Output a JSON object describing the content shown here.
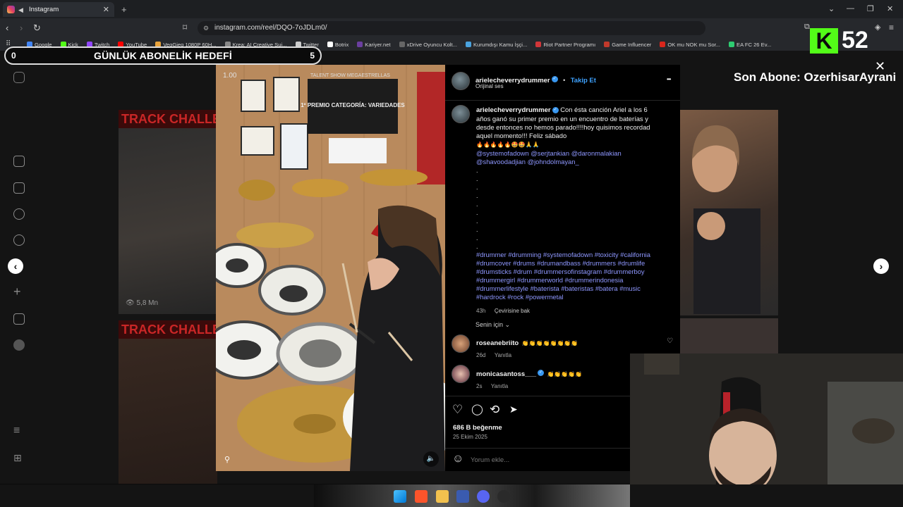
{
  "browser": {
    "tab_title": "Instagram",
    "url": "instagram.com/reel/DQO-7oJDLm0/",
    "bookmarks": [
      "Google",
      "Kick",
      "Twitch",
      "YouTube",
      "VegGieg 1080P 60H...",
      "Krea: AI Creative Sui...",
      "Twitter",
      "Botrix",
      "Kariyer.net",
      "xDrive Oyuncu Kolt...",
      "Kurumdışı Kamu İşçi...",
      "Riot Partner Programı",
      "Game Influencer",
      "OK mu NOK mu Sor...",
      "EA FC 26 Ev..."
    ],
    "bookmark_colors": [
      "#4285f4",
      "#53fc18",
      "#9146ff",
      "#ff0000",
      "#e8a33c",
      "#888888",
      "#cccccc",
      "#ffffff",
      "#6b3fa0",
      "#666666",
      "#4aa3df",
      "#d13639",
      "#c0392b",
      "#d9261c",
      "#2ecc71"
    ]
  },
  "overlay": {
    "goal_left": "0",
    "goal_title": "GÜNLÜK ABONELİK HEDEFİ",
    "goal_right": "5",
    "kick_logo": "K",
    "kick_count": "52",
    "last_sub": "Son Abone: OzerhisarAyrani"
  },
  "background": {
    "track_label_1": "TRACK CHALLE",
    "track_label_2": "TRACK CHALLE",
    "views": "5,8 Mn"
  },
  "video": {
    "counter": "1.00",
    "poster_title": "1º PREMIO CATEGORÍA: VARIEDADES",
    "banner": "TALENT SHOW MEGAESTRELLAS"
  },
  "post": {
    "username": "arielecheverrydrummer",
    "follow": "Takip Et",
    "audio": "Orijinal ses",
    "caption": "Con ésta canción Ariel a los 6 años ganó su primer premio en un encuentro de baterías y desde entonces no hemos parado!!!!hoy quisimos recordad aquel momento!!! Feliz sábado",
    "emojis": "🔥🔥🔥🔥🔥🤩🤩🙏🙏",
    "mentions": "@systemofadown @serjtankian @daronmalakian @shavoodadjian @johndolmayan_",
    "hashtags": "#drummer #drumming #systemofadown #toxicity #california #drumcover #drums #drumandbass #drummers #drumlife #drumsticks #drum #drummersofinstagram #drummerboy #drummergirl #drummerworld #drummerindonesia #drummerlifestyle #baterista #bateristas #batera #music #hardrock #rock #powermetal",
    "age": "43h",
    "translate": "Çevirisine bak",
    "filter": "Senin için",
    "likes": "686 B beğenme",
    "date": "25 Ekim 2025",
    "comment_placeholder": "Yorum ekle..."
  },
  "comments": [
    {
      "user": "roseanebriito",
      "text": "👏👏👏👏👏👏👏👏",
      "age": "26d",
      "reply": "Yanıtla"
    },
    {
      "user": "monicasantoss___",
      "text": "👏👏👏👏👏",
      "age": "2s",
      "reply": "Yanıtla"
    }
  ],
  "icons": {
    "close": "✕",
    "prev": "‹",
    "next": "›",
    "more": "•••",
    "like": "♡",
    "comment": "◯",
    "share": "➤",
    "repost": "⟲",
    "heart_small": "♡",
    "mute": "🔈",
    "emoji": "☺"
  }
}
